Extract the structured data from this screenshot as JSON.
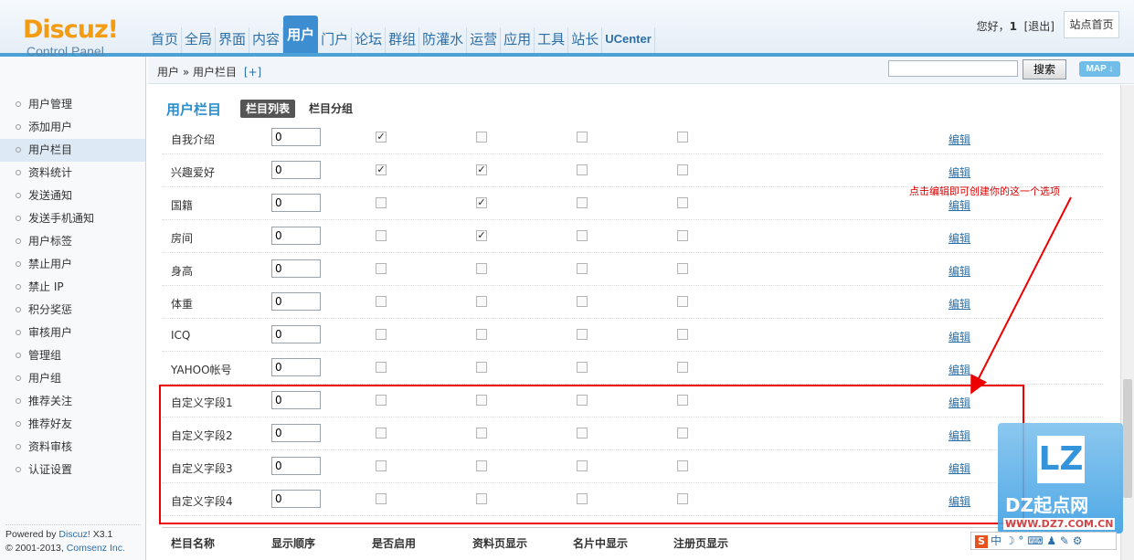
{
  "logo": {
    "name": "Discuz!",
    "subtitle": "Control Panel"
  },
  "nav": [
    {
      "label": "首页",
      "active": false
    },
    {
      "label": "全局",
      "active": false
    },
    {
      "label": "界面",
      "active": false
    },
    {
      "label": "内容",
      "active": false
    },
    {
      "label": "用户",
      "active": true
    },
    {
      "label": "门户",
      "active": false
    },
    {
      "label": "论坛",
      "active": false
    },
    {
      "label": "群组",
      "active": false
    },
    {
      "label": "防灌水",
      "active": false
    },
    {
      "label": "运营",
      "active": false
    },
    {
      "label": "应用",
      "active": false
    },
    {
      "label": "工具",
      "active": false
    },
    {
      "label": "站长",
      "active": false
    },
    {
      "label": "UCenter",
      "active": false
    }
  ],
  "userbox": {
    "greeting": "您好，",
    "username": "1",
    "logout": "[退出]",
    "site_home": "站点首页"
  },
  "subbar": {
    "breadcrumb": "用户 » 用户栏目",
    "add": "[+]",
    "search_value": "",
    "search_button": "搜索",
    "map": "MAP ↓"
  },
  "sidebar": {
    "items": [
      {
        "label": "用户管理",
        "active": false
      },
      {
        "label": "添加用户",
        "active": false
      },
      {
        "label": "用户栏目",
        "active": true
      },
      {
        "label": "资料统计",
        "active": false
      },
      {
        "label": "发送通知",
        "active": false
      },
      {
        "label": "发送手机通知",
        "active": false
      },
      {
        "label": "用户标签",
        "active": false
      },
      {
        "label": "禁止用户",
        "active": false
      },
      {
        "label": "禁止 IP",
        "active": false
      },
      {
        "label": "积分奖惩",
        "active": false
      },
      {
        "label": "审核用户",
        "active": false
      },
      {
        "label": "管理组",
        "active": false
      },
      {
        "label": "用户组",
        "active": false
      },
      {
        "label": "推荐关注",
        "active": false
      },
      {
        "label": "推荐好友",
        "active": false
      },
      {
        "label": "资料审核",
        "active": false
      },
      {
        "label": "认证设置",
        "active": false
      }
    ],
    "footer_line1_prefix": "Powered by ",
    "footer_line1_brand": "Discuz!",
    "footer_line1_version": " X3.1",
    "footer_line2_prefix": "© 2001-2013, ",
    "footer_line2_brand": "Comsenz Inc."
  },
  "main": {
    "title": "用户栏目",
    "tab_list": "栏目列表",
    "tab_group": "栏目分组",
    "edit_label": "编辑",
    "rows": [
      {
        "name": "自我介绍",
        "order": "0",
        "checks": [
          true,
          false,
          false,
          false
        ]
      },
      {
        "name": "兴趣爱好",
        "order": "0",
        "checks": [
          true,
          true,
          false,
          false
        ]
      },
      {
        "name": "国籍",
        "order": "0",
        "checks": [
          false,
          true,
          false,
          false
        ]
      },
      {
        "name": "房间",
        "order": "0",
        "checks": [
          false,
          true,
          false,
          false
        ]
      },
      {
        "name": "身高",
        "order": "0",
        "checks": [
          false,
          false,
          false,
          false
        ]
      },
      {
        "name": "体重",
        "order": "0",
        "checks": [
          false,
          false,
          false,
          false
        ]
      },
      {
        "name": "ICQ",
        "order": "0",
        "checks": [
          false,
          false,
          false,
          false
        ]
      },
      {
        "name": "YAHOO帐号",
        "order": "0",
        "checks": [
          false,
          false,
          false,
          false
        ]
      },
      {
        "name": "自定义字段1",
        "order": "0",
        "checks": [
          false,
          false,
          false,
          false
        ]
      },
      {
        "name": "自定义字段2",
        "order": "0",
        "checks": [
          false,
          false,
          false,
          false
        ]
      },
      {
        "name": "自定义字段3",
        "order": "0",
        "checks": [
          false,
          false,
          false,
          false
        ]
      },
      {
        "name": "自定义字段4",
        "order": "0",
        "checks": [
          false,
          false,
          false,
          false
        ]
      }
    ],
    "columns": [
      "栏目名称",
      "显示顺序",
      "是否启用",
      "资料页显示",
      "名片中显示",
      "注册页显示"
    ]
  },
  "annotation": "点击编辑即可创建你的这一个选项",
  "watermark": {
    "logo": "LZ",
    "name": "DZ起点网",
    "url": "WWW.DZ7.COM.CN"
  },
  "ime": {
    "badge": "S",
    "text": "中 ☽ ° ⌨ ♟ ✎ ⚙"
  },
  "colors": {
    "accent": "#3d8ed0",
    "link": "#2b6fa8",
    "annotation": "#e00000",
    "logo": "#f39c12"
  }
}
